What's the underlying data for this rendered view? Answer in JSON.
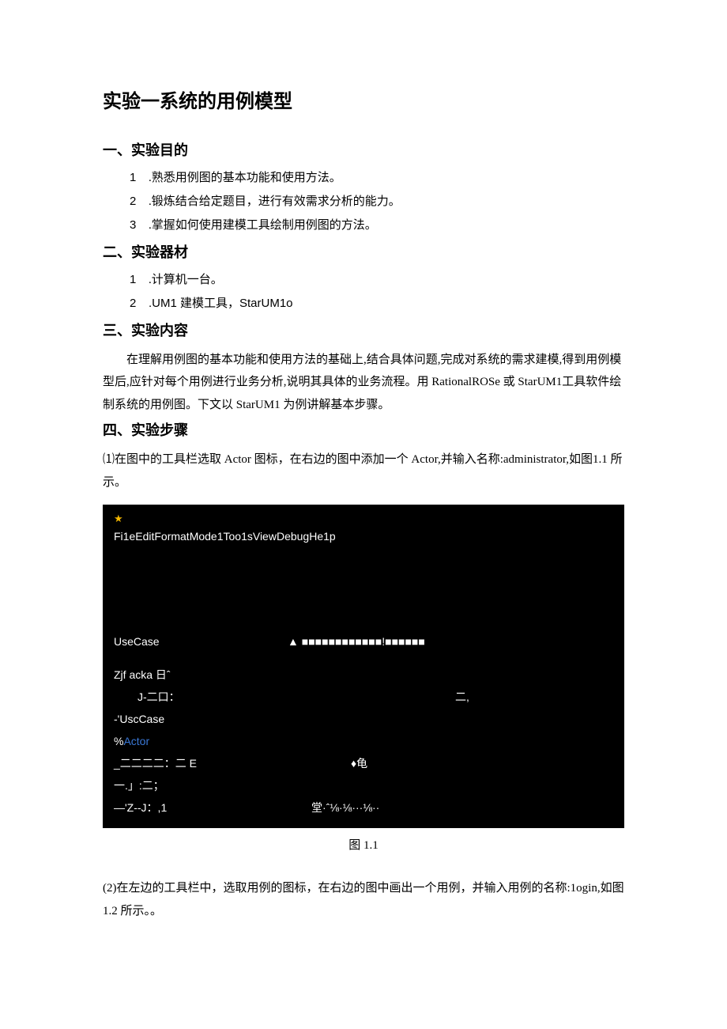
{
  "title": "实验一系统的用例模型",
  "sec1": {
    "heading": "一、实验目的",
    "items": [
      {
        "n": "1",
        "t": ".熟悉用例图的基本功能和使用方法。"
      },
      {
        "n": "2",
        "t": ".锻炼结合给定题目，进行有效需求分析的能力。"
      },
      {
        "n": "3",
        "t": ".掌握如何使用建模工具绘制用例图的方法。"
      }
    ]
  },
  "sec2": {
    "heading": "二、实验器材",
    "items": [
      {
        "n": "1",
        "t": ".计算机一台。"
      },
      {
        "n": "2",
        "t": ".UM1 建模工具，StarUM1o"
      }
    ]
  },
  "sec3": {
    "heading": "三、实验内容",
    "para": "在理解用例图的基本功能和使用方法的基础上,结合具体问题,完成对系统的需求建模,得到用例模型后,应针对每个用例进行业务分析,说明其具体的业务流程。用 RationalROSe 或 StarUM1工具软件绘制系统的用例图。下文以 StarUM1 为例讲解基本步骤。"
  },
  "sec4": {
    "heading": "四、实验步骤",
    "step1": "⑴在图中的工具栏选取 Actor 图标，在右边的图中添加一个 Actor,并输入名称:administrator,如图1.1 所示。",
    "step2": "(2)在左边的工具栏中，选取用例的图标，在右边的图中画出一个用例，并输入用例的名称:1ogin,如图 1.2 所示。。"
  },
  "shot": {
    "star": "★",
    "menubar": "Fi1eEditFormatMode1Too1sViewDebugHe1p",
    "row_usecase_l": "UseCase",
    "row_usecase_r": "▲ ■■■■■■■■■■■■!■■■■■■",
    "row_zjf": "Zjf acka 日ˆ",
    "row_j_l": "J-二口：",
    "row_j_r": "二,",
    "row_usc": "-'UscCase",
    "row_actor": "%Actor",
    "row_eee_l": "_二二二二：二 E",
    "row_eee_r": "♦龟",
    "row_dash": "一.」:二；",
    "row_zj_l": "—'Z--J：,1",
    "row_zj_r": "堂·ˆ⅛·⅛···⅛··"
  },
  "caption1": "图 1.1"
}
